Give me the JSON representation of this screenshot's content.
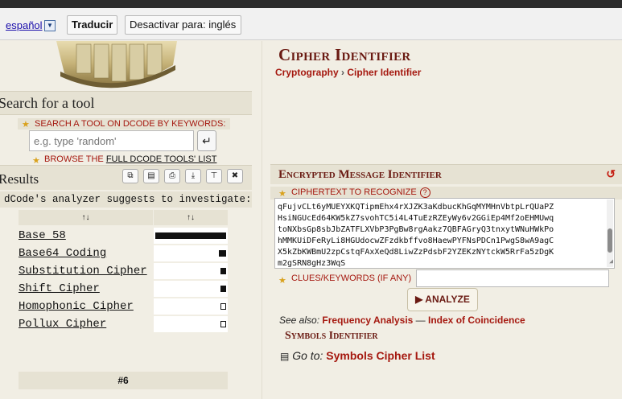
{
  "translate_bar": {
    "language": "español",
    "translate_label": "Traducir",
    "disable_label": "Desactivar para: inglés"
  },
  "left": {
    "search_heading": "Search for a tool",
    "search_label": "SEARCH A TOOL ON DCODE BY KEYWORDS:",
    "search_placeholder": "e.g. type 'random'",
    "browse_prefix": "BROWSE THE",
    "browse_link": "FULL DCODE TOOLS' LIST",
    "results_heading": "Results",
    "analyzer_text": "dCode's analyzer suggests to investigate:",
    "table": {
      "col1": "↑↓",
      "col2": "↑↓",
      "rows": [
        {
          "name": "Base 58",
          "score": 1.0
        },
        {
          "name": "Base64 Coding",
          "score": 0.1
        },
        {
          "name": "Substitution Cipher",
          "score": 0.07
        },
        {
          "name": "Shift Cipher",
          "score": 0.07
        },
        {
          "name": "Homophonic Cipher",
          "score": 0.05
        },
        {
          "name": "Pollux Cipher",
          "score": 0.05
        }
      ],
      "footer": "#6"
    }
  },
  "right": {
    "page_title": "Cipher Identifier",
    "breadcrumb_parent": "Cryptography",
    "breadcrumb_sep": "›",
    "breadcrumb_current": "Cipher Identifier",
    "section_title": "Encrypted Message Identifier",
    "ciphertext_label": "CIPHERTEXT TO RECOGNIZE",
    "ciphertext_lines": [
      "qFujvCLt6yMUEYXKQTipmEhx4rXJZK3aKdbucKhGqMYMHnVbtpLrQUaPZ",
      "HsiNGUcEd64KW5kZ7svohTC5i4L4TuEzRZEyWy6v2GGiEp4Mf2oEHMUwq",
      "toNXbsGp8sbJbZATFLXVbP3PgBw8rgAakz7QBFAGryQ3tnxytWNuHWkPo",
      "hMMKUiDFeRyLi8HGUdocwZFzdkbffvo8HaewPYFNsPDCn1PwgS8wA9agC",
      "X5kZbKWBmU2zpCstqFAxXeQd8LiwZzPdsbF2YZEKzNYtckW5RrFa5zDgK",
      "m2gSRN8gHz3WqS"
    ],
    "clues_label": "CLUES/KEYWORDS (IF ANY)",
    "analyze_label": "▶ ANALYZE",
    "see_also_label": "See also:",
    "see_also_link1": "Frequency Analysis",
    "see_also_dash": "—",
    "see_also_link2": "Index of Coincidence",
    "symbols_identifier": "Symbols Identifier",
    "goto_label": "Go to:",
    "goto_link": "Symbols Cipher List"
  }
}
